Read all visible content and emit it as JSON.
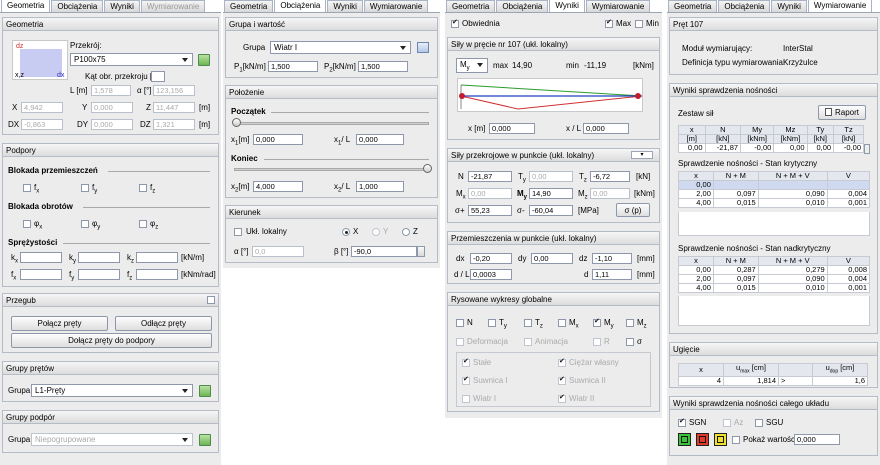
{
  "p1": {
    "tabs": [
      "Geometria",
      "Obciążenia",
      "Wyniki",
      "Wymiarowanie"
    ],
    "geometria": {
      "title": "Geometria",
      "przekroj_label": "Przekrój:",
      "przekroj_value": "P100x75",
      "kat_label": "Kąt obr. przekroju [°]",
      "kat_value": "0",
      "L_label": "L [m]",
      "L_value": "1,578",
      "alfa_label": "α [°]",
      "alfa_value": "123,156",
      "X_label": "X",
      "X_value": "4,942",
      "Y_label": "Y",
      "Y_value": "0,000",
      "Z_label": "Z",
      "Z_value": "11,447",
      "m_unit": "[m]",
      "DX_label": "DX",
      "DX_value": "-0,863",
      "DY_label": "DY",
      "DY_value": "0,000",
      "DZ_label": "DZ",
      "DZ_value": "1,321",
      "dz": "dz",
      "dx": "dx",
      "xz": "x,z"
    },
    "podpory": {
      "title": "Podpory",
      "blokada_przem": "Blokada przemieszczeń",
      "fx": "f",
      "fy": "f",
      "fz": "f",
      "sx": "x",
      "sy": "y",
      "sz": "z",
      "blokada_obr": "Blokada obrotów",
      "phi": "φ",
      "sprez": "Sprężystości",
      "k": "k",
      "f": "f",
      "kN_m": "[kN/m]",
      "kNm_rad": "[kNm/rad]"
    },
    "przegub": {
      "title": "Przegub",
      "polacz": "Połącz pręty",
      "odlacz": "Odłącz pręty",
      "dolacz": "Dołącz pręty do podpory"
    },
    "grupy_pretow": {
      "title": "Grupy prętów",
      "label": "Grupa",
      "value": "L1-Pręty"
    },
    "grupy_podpor": {
      "title": "Grupy podpór",
      "label": "Grupa",
      "value": "Niepogrupowane"
    }
  },
  "p2": {
    "tabs": [
      "Geometria",
      "Obciążenia",
      "Wyniki",
      "Wymiarowanie"
    ],
    "grupa": {
      "title": "Grupa i wartość",
      "label": "Grupa",
      "value": "Wiatr I",
      "P1_label": "P",
      "P1_sub": "1",
      "P1_unit": "[kN/m]",
      "P1_value": "1,500",
      "P2_label": "P",
      "P2_sub": "2",
      "P2_unit": "[kN/m]",
      "P2_value": "1,500"
    },
    "polozenie": {
      "title": "Położenie",
      "poczatek": "Początek",
      "x1_label": "x",
      "x1_sub": "1",
      "x1_unit": "[m]",
      "x1_value": "0,000",
      "x1L_label": "x",
      "x1L_sub": "1",
      "x1L_unit": "/ L",
      "x1L_value": "0,000",
      "koniec": "Koniec",
      "x2_label": "x",
      "x2_sub": "2",
      "x2_unit": "[m]",
      "x2_value": "4,000",
      "x2L_label": "x",
      "x2L_sub": "2",
      "x2L_unit": "/ L",
      "x2L_value": "1,000"
    },
    "kierunek": {
      "title": "Kierunek",
      "ukl": "Ukł. lokalny",
      "X": "X",
      "Y": "Y",
      "Z": "Z",
      "alfa_label": "α [°]",
      "alfa_value": "0,0",
      "beta_label": "β [°]",
      "beta_value": "-90,0"
    }
  },
  "p3": {
    "tabs": [
      "Geometria",
      "Obciążenia",
      "Wyniki",
      "Wymiarowanie"
    ],
    "top": {
      "obwiednia": "Obwiednia",
      "max": "Max",
      "min": "Min"
    },
    "sily": {
      "title": "Siły w pręcie nr 107 (ukł. lokalny)",
      "my": "M",
      "my_sub": "y",
      "max_label": "max",
      "max_value": "14,90",
      "min_label": "min",
      "min_value": "-11,19",
      "unit": "[kNm]",
      "x_label": "x [m]",
      "x_value": "0,000",
      "xL_label": "x / L",
      "xL_value": "0,000"
    },
    "przekrojowe": {
      "title": "Siły przekrojowe w punkcie (ukł. lokalny)",
      "N_label": "N",
      "N_value": "-21,87",
      "Ty_label": "T",
      "Ty_sub": "y",
      "Ty_value": "0,00",
      "Tz_label": "T",
      "Tz_sub": "z",
      "Tz_value": "-6,72",
      "kN": "[kN]",
      "Mx_label": "M",
      "Mx_sub": "x",
      "Mx_value": "0,00",
      "My_label": "M",
      "My_sub": "y",
      "My_value": "14,90",
      "Mz_label": "M",
      "Mz_sub": "z",
      "Mz_value": "0,00",
      "kNm": "[kNm]",
      "sp_label": "σ+",
      "sp_value": "55,23",
      "sm_label": "σ-",
      "sm_value": "-60,04",
      "MPa": "[MPa]",
      "sbtn": "σ (p)"
    },
    "przem": {
      "title": "Przemieszczenia w punkcie (ukł. lokalny)",
      "dx_label": "dx",
      "dx_value": "-0,20",
      "dy_label": "dy",
      "dy_value": "0,00",
      "dz_label": "dz",
      "dz_value": "-1,10",
      "mm": "[mm]",
      "dL_label": "d / L",
      "dL_value": "0,0003",
      "d_label": "d",
      "d_value": "1,11"
    },
    "rys": {
      "title": "Rysowane wykresy globalne",
      "N": "N",
      "T": "T",
      "M": "M",
      "y": "y",
      "z": "z",
      "x": "x",
      "deform": "Deformacja",
      "anim": "Animacja",
      "R": "R",
      "sigma": "σ",
      "stale": "Stałe",
      "ciezar": "Ciężar własny",
      "suwnica1": "Suwnica I",
      "suwnica2": "Suwnica II",
      "wiatr1": "Wiatr I",
      "wiatr2": "Wiatr II"
    }
  },
  "p4": {
    "tabs": [
      "Geometria",
      "Obciążenia",
      "Wyniki",
      "Wymiarowanie"
    ],
    "pret": {
      "title": "Pręt 107",
      "modul_label": "Moduł wymiarujący:",
      "modul_value": "InterStal",
      "def_label": "Definicja typu wymiarowania:",
      "def_value": "Krzyżulce"
    },
    "wyniki": {
      "title": "Wyniki sprawdzenia nośności",
      "zestaw": "Zestaw sił",
      "raport": "Raport",
      "sily_head": [
        "x",
        "N",
        "My",
        "Mz",
        "Ty",
        "Tz"
      ],
      "sily_units": [
        "[m]",
        "[kN]",
        "[kNm]",
        "[kNm]",
        "[kN]",
        "[kN]"
      ],
      "sily_row": [
        "0,00",
        "-21,87",
        "-0,00",
        "0,00",
        "0,00",
        "-0,00"
      ],
      "kryt_title": "Sprawdzenie nośności - Stan krytyczny",
      "kryt_head": [
        "x",
        "N + M",
        "N + M + V",
        "V"
      ],
      "kryt_rows": [
        [
          "0,00",
          "",
          "",
          ""
        ],
        [
          "2,00",
          "0,097",
          "0,090",
          "0,004"
        ],
        [
          "4,00",
          "0,015",
          "0,010",
          "0,001"
        ]
      ],
      "nadkr_title": "Sprawdzenie nośności - Stan nadkrytyczny",
      "nadkr_head": [
        "x",
        "N + M",
        "N + M + V",
        "V"
      ],
      "nadkr_rows": [
        [
          "0,00",
          "0,287",
          "0,279",
          "0,008"
        ],
        [
          "2,00",
          "0,097",
          "0,090",
          "0,004"
        ],
        [
          "4,00",
          "0,015",
          "0,010",
          "0,001"
        ]
      ]
    },
    "ugiecie": {
      "title": "Ugięcie",
      "head_x": "x",
      "head_u": "u",
      "head_u_sub": "max",
      "head_u_unit": "[cm]",
      "head_ud": "u",
      "head_ud_sub": "dop",
      "head_ud_unit": "[cm]",
      "x": "4",
      "u": "1,814",
      "rel": ">",
      "ud": "1,6"
    },
    "caly": {
      "title": "Wyniki sprawdzenia nośności całego układu",
      "sgn": "SGN",
      "az": "Az",
      "sgu": "SGU",
      "pokaz": "Pokaż wartości >",
      "pokaz_value": "0,000"
    }
  }
}
